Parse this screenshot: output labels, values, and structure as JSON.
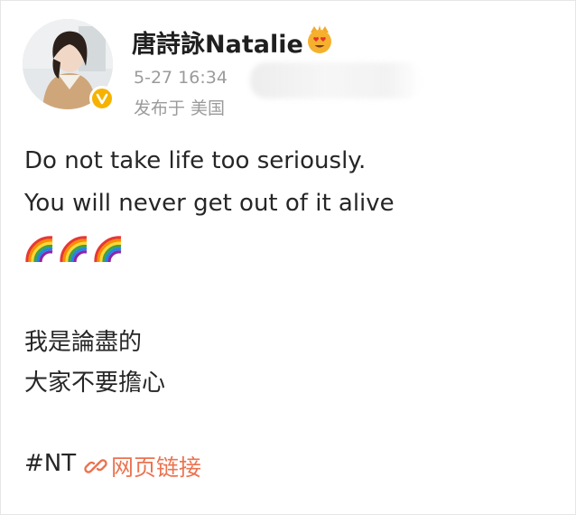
{
  "author": {
    "name": "唐詩詠Natalie",
    "avatar_icon": "profile-photo",
    "verified_badge_icon": "verified-v-icon",
    "vip_badge_icon": "heart-eyes-crown-icon"
  },
  "meta": {
    "timestamp": "5-27 16:34",
    "location": "发布于 美国"
  },
  "content": {
    "line1": "Do not take life too seriously.",
    "line2": "You will never get out of it alive",
    "emoji_icons": [
      "rainbow-icon",
      "rainbow-icon",
      "rainbow-icon"
    ],
    "line3": "我是論盡的",
    "line4": "大家不要擔心"
  },
  "footer": {
    "hashtag": "#NT",
    "link_label": "网页链接",
    "link_icon": "link-icon"
  },
  "colors": {
    "link": "#eb7350",
    "meta": "#9b9b9b",
    "verified": "#f5b300",
    "text": "#262626"
  }
}
